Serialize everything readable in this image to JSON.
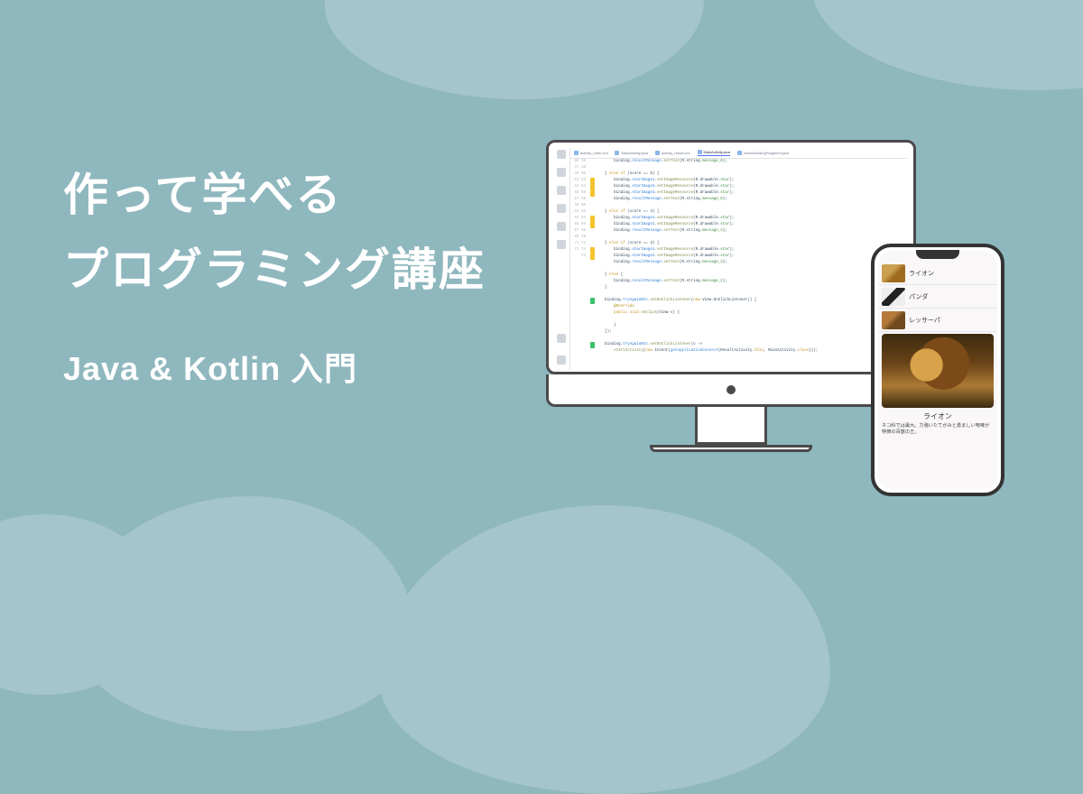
{
  "title": {
    "line1": "作って学べる",
    "line2": "プログラミング講座"
  },
  "subtitle": "Java & Kotlin 入門",
  "ide": {
    "tabs": [
      {
        "label": "activity_main.xml"
      },
      {
        "label": "MainActivity.java"
      },
      {
        "label": "activity_result.xml"
      },
      {
        "label": "MainActivity.java",
        "active": true
      },
      {
        "label": "AnswerDialogFragment.java"
      }
    ],
    "code_lines": [
      {
        "n": 45,
        "t": "        binding.<cls>resultMessage</cls>.<fn>setText</fn>(R.string.<str>message_0</str>);"
      },
      {
        "n": 46,
        "t": ""
      },
      {
        "n": 47,
        "t": "    } <kw>else if</kw> (score == 5) {"
      },
      {
        "n": 48,
        "m": "y",
        "t": "        binding.<cls>starImage1</cls>.<fn>setImageResource</fn>(R.drawable.<str>star</str>);"
      },
      {
        "n": 49,
        "m": "y",
        "t": "        binding.<cls>starImage2</cls>.<fn>setImageResource</fn>(R.drawable.<str>star</str>);"
      },
      {
        "n": 50,
        "m": "y",
        "t": "        binding.<cls>starImage3</cls>.<fn>setImageResource</fn>(R.drawable.<str>star</str>);"
      },
      {
        "n": 51,
        "t": "        binding.<cls>resultMessage</cls>.<fn>setText</fn>(R.string.<str>message_5</str>);"
      },
      {
        "n": 52,
        "t": ""
      },
      {
        "n": 53,
        "t": "    } <kw>else if</kw> (score == 4) {"
      },
      {
        "n": 54,
        "m": "y",
        "t": "        binding.<cls>starImage1</cls>.<fn>setImageResource</fn>(R.drawable.<str>star</str>);"
      },
      {
        "n": 55,
        "m": "y",
        "t": "        binding.<cls>starImage2</cls>.<fn>setImageResource</fn>(R.drawable.<str>star</str>);"
      },
      {
        "n": 56,
        "t": "        binding.<cls>resultMessage</cls>.<fn>setText</fn>(R.string.<str>message_4</str>);"
      },
      {
        "n": 57,
        "t": ""
      },
      {
        "n": 58,
        "t": "    } <kw>else if</kw> (score == 3) {"
      },
      {
        "n": 59,
        "m": "y",
        "t": "        binding.<cls>starImage1</cls>.<fn>setImageResource</fn>(R.drawable.<str>star</str>);"
      },
      {
        "n": 60,
        "m": "y",
        "t": "        binding.<cls>starImage2</cls>.<fn>setImageResource</fn>(R.drawable.<str>star</str>);"
      },
      {
        "n": 61,
        "t": "        binding.<cls>resultMessage</cls>.<fn>setText</fn>(R.string.<str>message_3</str>);"
      },
      {
        "n": 62,
        "t": ""
      },
      {
        "n": 63,
        "t": "    } <kw>else</kw> {"
      },
      {
        "n": 64,
        "t": "        binding.<cls>resultMessage</cls>.<fn>setText</fn>(R.string.<str>message_2</str>);"
      },
      {
        "n": 65,
        "t": "    }"
      },
      {
        "n": 66,
        "t": ""
      },
      {
        "n": 67,
        "m": "g",
        "t": "    binding.<cls>tryAgainBtn</cls>.<fn>setOnClickListener</fn>(<kw>new</kw> View.OnClickListener() {"
      },
      {
        "n": 68,
        "t": "        <ann>@Override</ann>"
      },
      {
        "n": 69,
        "t": "        <kw>public void</kw> <fn>onClick</fn>(View v) {"
      },
      {
        "n": 70,
        "t": ""
      },
      {
        "n": 71,
        "t": "        }"
      },
      {
        "n": 72,
        "t": "    });"
      },
      {
        "n": 73,
        "t": ""
      },
      {
        "n": 74,
        "m": "g",
        "t": "    binding.<cls>tryAgainBtn</cls>.<fn>setOnClickListener</fn>(v ->"
      },
      {
        "n": 75,
        "t": "        <fn>startActivity</fn>(<kw>new</kw> Intent(<cls>getApplicationContext</cls>(ResultActivity.<kw>this</kw>, MainActivity.<kw>class</kw>)));"
      }
    ]
  },
  "app": {
    "list": [
      {
        "label": "ライオン",
        "thumb": "thumb-lion"
      },
      {
        "label": "パンダ",
        "thumb": "thumb-panda"
      },
      {
        "label": "レッサーパ",
        "thumb": "thumb-rp"
      }
    ],
    "detail": {
      "title": "ライオン",
      "desc": "ネコ科では最大。力強いたてがみと勇ましい咆哮が特徴の百獣の王。"
    }
  }
}
